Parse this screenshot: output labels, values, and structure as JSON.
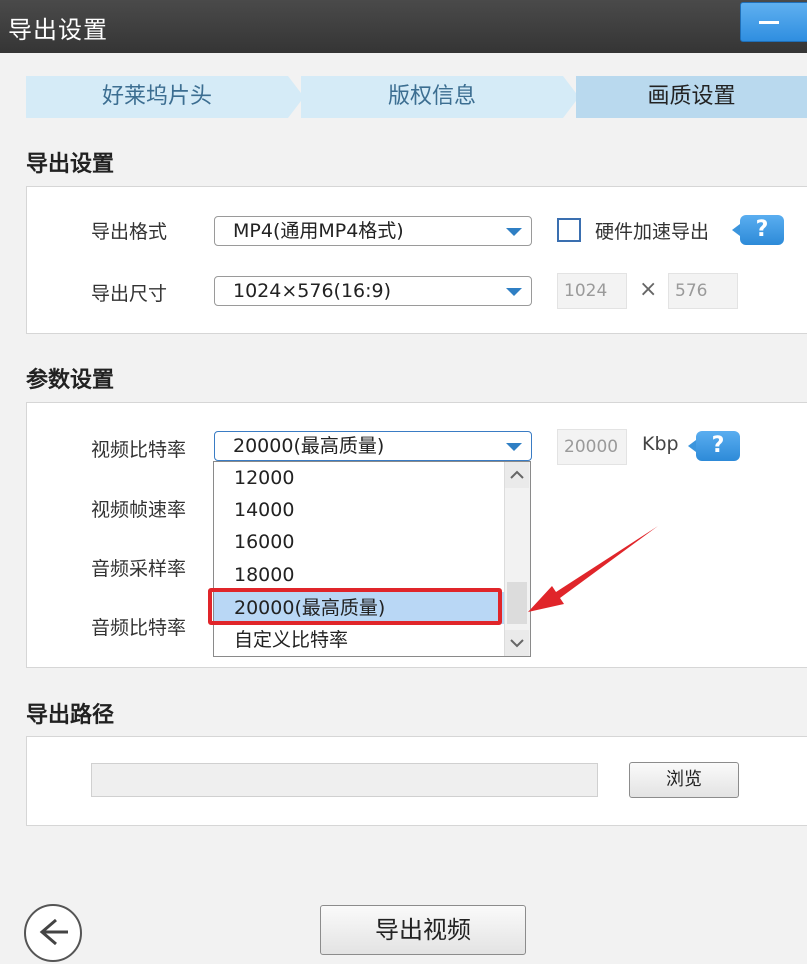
{
  "window": {
    "title": "导出设置"
  },
  "steps": [
    "好莱坞片头",
    "版权信息",
    "画质设置"
  ],
  "sections": {
    "export": "导出设置",
    "params": "参数设置",
    "path": "导出路径"
  },
  "export_settings": {
    "format_label": "导出格式",
    "format_value": "MP4(通用MP4格式)",
    "hw_label": "硬件加速导出",
    "size_label": "导出尺寸",
    "size_value": "1024×576(16:9)",
    "width": "1024",
    "times": "×",
    "height": "576"
  },
  "params": {
    "video_bitrate_label": "视频比特率",
    "video_bitrate_value": "20000(最高质量)",
    "bitrate_box": "20000",
    "unit": "Kbp",
    "fps_label": "视频帧速率",
    "audio_rate_label": "音频采样率",
    "audio_bitrate_label": "音频比特率",
    "options": [
      "12000",
      "14000",
      "16000",
      "18000",
      "20000(最高质量)",
      "自定义比特率"
    ],
    "selected_index": 4
  },
  "path": {
    "value": "",
    "browse": "浏览"
  },
  "footer": {
    "export_button": "导出视频"
  },
  "help_glyph": "?",
  "colors": {
    "accent": "#2f8ee0",
    "highlight": "#e0252a",
    "selected": "#b9d7f5"
  }
}
